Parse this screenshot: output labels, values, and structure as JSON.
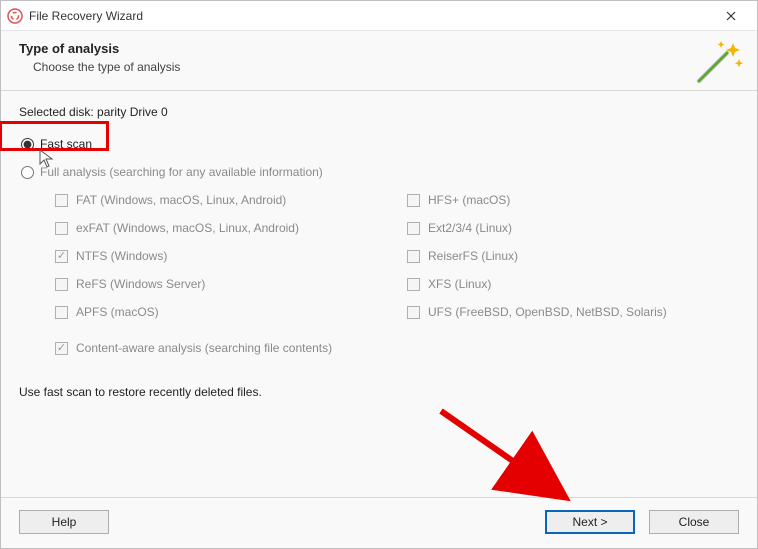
{
  "titlebar": {
    "title": "File Recovery Wizard"
  },
  "header": {
    "heading": "Type of analysis",
    "subtitle": "Choose the type of analysis"
  },
  "selected_disk_label": "Selected disk: parity Drive 0",
  "radio": {
    "fast": "Fast scan",
    "full": "Full analysis (searching for any available information)"
  },
  "fs": {
    "fat": "FAT (Windows, macOS, Linux, Android)",
    "exfat": "exFAT (Windows, macOS, Linux, Android)",
    "ntfs": "NTFS (Windows)",
    "refs": "ReFS (Windows Server)",
    "apfs": "APFS (macOS)",
    "hfs": "HFS+ (macOS)",
    "ext": "Ext2/3/4 (Linux)",
    "reiser": "ReiserFS (Linux)",
    "xfs": "XFS (Linux)",
    "ufs": "UFS (FreeBSD, OpenBSD, NetBSD, Solaris)"
  },
  "content_aware_label": "Content-aware analysis (searching file contents)",
  "hint": "Use fast scan to restore recently deleted files.",
  "buttons": {
    "help": "Help",
    "next": "Next >",
    "close": "Close"
  },
  "state": {
    "selected_radio": "fast",
    "checked_fs": [
      "ntfs"
    ],
    "content_aware_checked": true,
    "full_options_enabled": false
  },
  "colors": {
    "highlight": "#e40000",
    "primary_border": "#0a66b8"
  }
}
